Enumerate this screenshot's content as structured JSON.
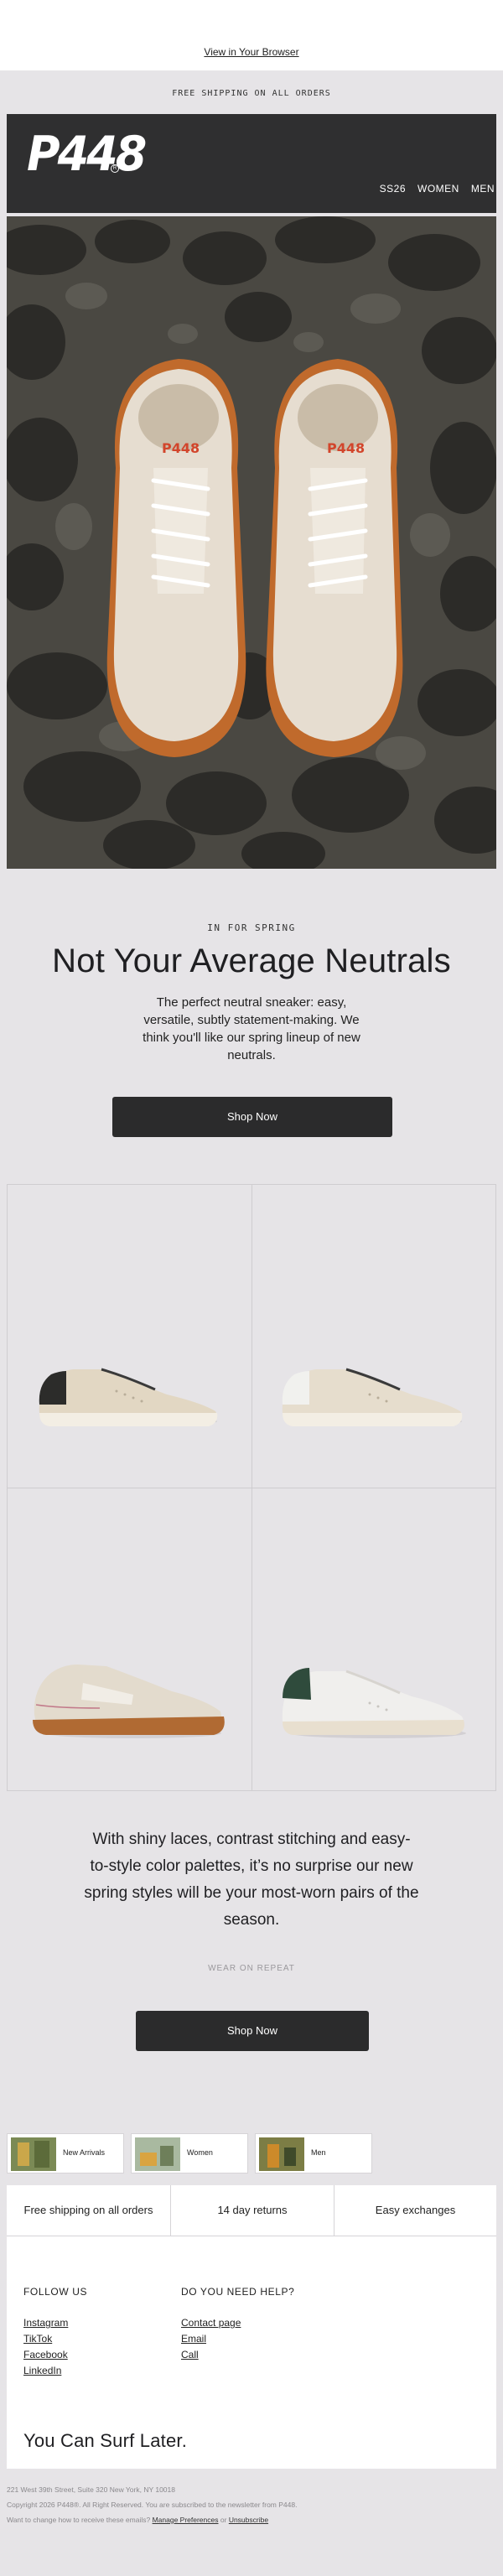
{
  "preheader": {
    "view_in_browser": "View in Your Browser"
  },
  "announcement": "FREE SHIPPING ON ALL ORDERS",
  "header": {
    "logo": "P448",
    "logo_mark": "R",
    "nav": [
      "SS26",
      "WOMEN",
      "MEN"
    ],
    "bg_color": "#2f2f30"
  },
  "hero": {
    "shoe_brand_tag": "P448"
  },
  "intro": {
    "eyebrow": "IN FOR SPRING",
    "headline": "Not Your Average Neutrals",
    "body": "The perfect neutral sneaker: easy, versatile, subtly statement-making. We think you'll like our spring lineup of new neutrals.",
    "cta": "Shop Now"
  },
  "products": [
    {
      "name": "sneaker-beige-black-heel"
    },
    {
      "name": "sneaker-beige-white-heel"
    },
    {
      "name": "sneaker-cream-gum-sole"
    },
    {
      "name": "sneaker-white-green-heel"
    }
  ],
  "story": {
    "paragraph": "With shiny laces, contrast stitching and easy-to-style color palettes, it’s no surprise our new spring styles will be your most-worn pairs of the season.",
    "tagline": "WEAR ON REPEAT",
    "cta": "Shop Now"
  },
  "categories": [
    {
      "label": "New Arrivals"
    },
    {
      "label": "Women"
    },
    {
      "label": "Men"
    }
  ],
  "footer": {
    "usps": [
      "Free shipping on all orders",
      "14 day returns",
      "Easy exchanges"
    ],
    "follow_title": "FOLLOW US",
    "follow_links": [
      "Instagram",
      "TikTok",
      "Facebook",
      "LinkedIn"
    ],
    "help_title": "DO YOU NEED HELP?",
    "help_links": [
      "Contact page",
      "Email",
      "Call"
    ],
    "slogan": "You Can Surf Later."
  },
  "legal": {
    "address": "221 West 39th Street, Suite 320 New York, NY 10018",
    "copyright": "Copyright 2026 P448®. All Right Reserved. You are subscribed to the newsletter from P448.",
    "prefs_text": "Want to change how to receive these emails?",
    "manage": "Manage Preferences",
    "or": "or",
    "unsubscribe": "Unsubscribe"
  },
  "colors": {
    "page_bg": "#e6e4e7",
    "button_bg": "#2b2b2c",
    "accent_logo_red": "#d2452b"
  }
}
